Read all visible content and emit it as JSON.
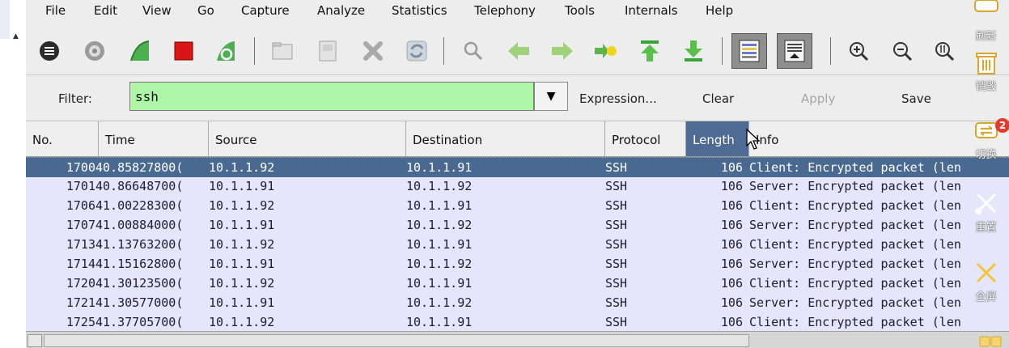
{
  "menu": [
    "File",
    "Edit",
    "View",
    "Go",
    "Capture",
    "Analyze",
    "Statistics",
    "Telephony",
    "Tools",
    "Internals",
    "Help"
  ],
  "toolbar": {
    "icons": [
      "interfaces-icon",
      "options-icon",
      "start-capture-icon",
      "stop-capture-icon",
      "restart-capture-icon",
      "open-file-icon",
      "save-file-icon",
      "close-file-icon",
      "reload-icon",
      "find-packet-icon",
      "go-back-icon",
      "go-forward-icon",
      "go-to-packet-icon",
      "go-first-icon",
      "go-last-icon",
      "colorize-icon",
      "auto-scroll-icon",
      "zoom-in-icon",
      "zoom-out-icon",
      "zoom-normal-icon"
    ]
  },
  "filter": {
    "label": "Filter:",
    "value": "ssh",
    "expression_label": "Expression...",
    "clear_label": "Clear",
    "apply_label": "Apply",
    "save_label": "Save"
  },
  "columns": [
    "No.",
    "Time",
    "Source",
    "Destination",
    "Protocol",
    "Length",
    "Info"
  ],
  "sorted_column": "Length",
  "packets": [
    {
      "no": "1700",
      "time": "40.85827800(",
      "source": "10.1.1.92",
      "destination": "10.1.1.91",
      "protocol": "SSH",
      "length": "106",
      "info": "Client: Encrypted packet (len",
      "selected": true
    },
    {
      "no": "1701",
      "time": "40.86648700(",
      "source": "10.1.1.91",
      "destination": "10.1.1.92",
      "protocol": "SSH",
      "length": "106",
      "info": "Server: Encrypted packet (len"
    },
    {
      "no": "1706",
      "time": "41.00228300(",
      "source": "10.1.1.92",
      "destination": "10.1.1.91",
      "protocol": "SSH",
      "length": "106",
      "info": "Client: Encrypted packet (len"
    },
    {
      "no": "1707",
      "time": "41.00884000(",
      "source": "10.1.1.91",
      "destination": "10.1.1.92",
      "protocol": "SSH",
      "length": "106",
      "info": "Server: Encrypted packet (len"
    },
    {
      "no": "1713",
      "time": "41.13763200(",
      "source": "10.1.1.92",
      "destination": "10.1.1.91",
      "protocol": "SSH",
      "length": "106",
      "info": "Client: Encrypted packet (len"
    },
    {
      "no": "1714",
      "time": "41.15162800(",
      "source": "10.1.1.91",
      "destination": "10.1.1.92",
      "protocol": "SSH",
      "length": "106",
      "info": "Server: Encrypted packet (len"
    },
    {
      "no": "1720",
      "time": "41.30123500(",
      "source": "10.1.1.92",
      "destination": "10.1.1.91",
      "protocol": "SSH",
      "length": "106",
      "info": "Client: Encrypted packet (len"
    },
    {
      "no": "1721",
      "time": "41.30577000(",
      "source": "10.1.1.91",
      "destination": "10.1.1.92",
      "protocol": "SSH",
      "length": "106",
      "info": "Server: Encrypted packet (len"
    },
    {
      "no": "1725",
      "time": "41.37705700(",
      "source": "10.1.1.92",
      "destination": "10.1.1.91",
      "protocol": "SSH",
      "length": "106",
      "info": "Client: Encrypted packet (len"
    }
  ],
  "dock": {
    "refresh_label": "刷新",
    "destroy_label": "销毁",
    "switch_label": "切换",
    "switch_badge": "2",
    "tool4_label": "重置",
    "tool5_label": "全屏"
  },
  "colors": {
    "filter_ok": "#aff5a8",
    "selected_row": "#4a6991",
    "row_bg": "#e5e5fb",
    "sorted_header": "#4e6b93"
  }
}
